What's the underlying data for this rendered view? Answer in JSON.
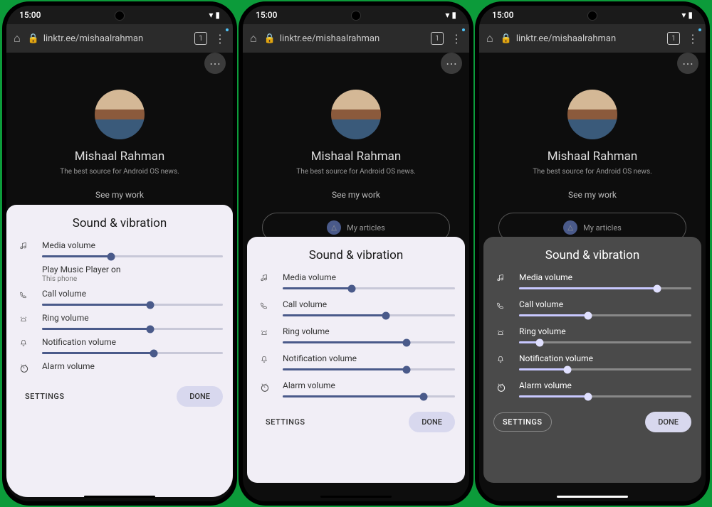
{
  "status": {
    "time": "15:00"
  },
  "browser": {
    "url": "linktr.ee/mishaalrahman",
    "tab_count": "1"
  },
  "profile": {
    "name": "Mishaal Rahman",
    "subtitle": "The best source for Android OS news.",
    "see_work": "See my work",
    "articles": "My articles"
  },
  "panels": [
    {
      "title": "Sound & vibration",
      "rows": [
        {
          "icon": "music",
          "label": "Media volume",
          "value": 38,
          "sublabel": "Play Music Player on",
          "sub2": "This phone"
        },
        {
          "icon": "phone",
          "label": "Call volume",
          "value": 60
        },
        {
          "icon": "ring",
          "label": "Ring volume",
          "value": 60
        },
        {
          "icon": "bell",
          "label": "Notification volume",
          "value": 62
        },
        {
          "icon": "alarm",
          "label": "Alarm volume",
          "value": null
        }
      ],
      "settings": "SETTINGS",
      "done": "DONE"
    },
    {
      "title": "Sound & vibration",
      "rows": [
        {
          "icon": "music",
          "label": "Media volume",
          "value": 40
        },
        {
          "icon": "phone",
          "label": "Call volume",
          "value": 60
        },
        {
          "icon": "ring",
          "label": "Ring volume",
          "value": 72
        },
        {
          "icon": "bell",
          "label": "Notification volume",
          "value": 72
        },
        {
          "icon": "alarm",
          "label": "Alarm volume",
          "value": 82
        }
      ],
      "settings": "SETTINGS",
      "done": "DONE"
    },
    {
      "title": "Sound & vibration",
      "rows": [
        {
          "icon": "music",
          "label": "Media volume",
          "value": 80
        },
        {
          "icon": "phone",
          "label": "Call volume",
          "value": 40
        },
        {
          "icon": "ring",
          "label": "Ring volume",
          "value": 12
        },
        {
          "icon": "bell",
          "label": "Notification volume",
          "value": 28
        },
        {
          "icon": "alarm",
          "label": "Alarm volume",
          "value": 40
        }
      ],
      "settings": "SETTINGS",
      "done": "DONE"
    }
  ]
}
